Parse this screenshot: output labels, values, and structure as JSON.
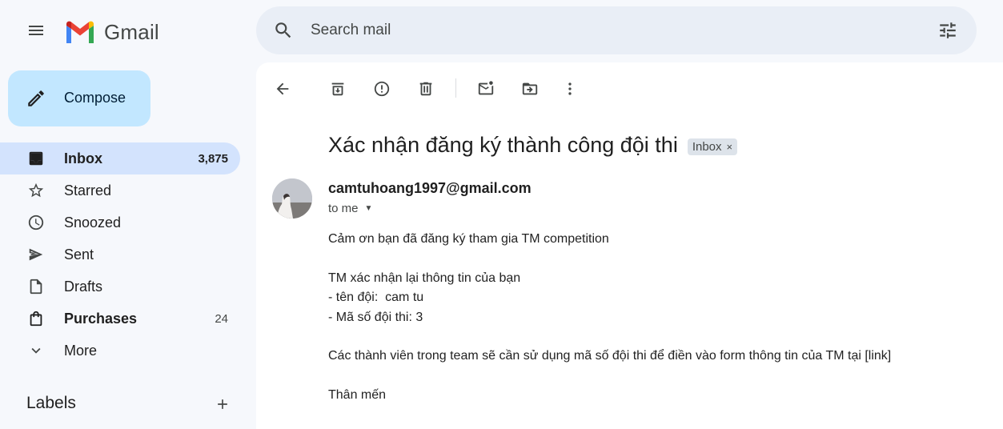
{
  "app": {
    "name": "Gmail"
  },
  "search": {
    "placeholder": "Search mail"
  },
  "compose": {
    "label": "Compose"
  },
  "sidebar": {
    "items": [
      {
        "label": "Inbox",
        "count": "3,875",
        "icon": "inbox-icon",
        "active": true,
        "bold": true
      },
      {
        "label": "Starred",
        "count": "",
        "icon": "star-icon"
      },
      {
        "label": "Snoozed",
        "count": "",
        "icon": "clock-icon"
      },
      {
        "label": "Sent",
        "count": "",
        "icon": "send-icon"
      },
      {
        "label": "Drafts",
        "count": "",
        "icon": "draft-icon"
      },
      {
        "label": "Purchases",
        "count": "24",
        "icon": "purchases-icon",
        "bold": true
      },
      {
        "label": "More",
        "count": "",
        "icon": "chevron-down-icon"
      }
    ],
    "labels_header": "Labels"
  },
  "toolbar": {
    "icons": [
      "back-icon",
      "archive-icon",
      "report-spam-icon",
      "delete-icon",
      "mark-unread-icon",
      "move-to-icon",
      "more-vert-icon"
    ]
  },
  "email": {
    "subject": "Xác nhận đăng ký thành công đội thi",
    "badge": "Inbox",
    "badge_close": "×",
    "sender": "camtuhoang1997@gmail.com",
    "recipient": "to me",
    "body": {
      "line1": "Cảm ơn bạn đã đăng ký tham gia TM competition",
      "line2": "TM xác nhận lại thông tin của bạn",
      "line3": "- tên đội:  cam tu",
      "line4": "- Mã số đội thi: 3",
      "line5": "Các thành viên trong team sẽ cần sử dụng mã số đội thi để điền vào form thông tin của TM tại [link]",
      "line6": "Thân mến"
    }
  },
  "colors": {
    "background": "#f6f8fc",
    "search_bg": "#e9eef6",
    "compose_bg": "#c2e7ff",
    "active_nav_bg": "#d3e3fd",
    "badge_bg": "#dde3ea"
  }
}
